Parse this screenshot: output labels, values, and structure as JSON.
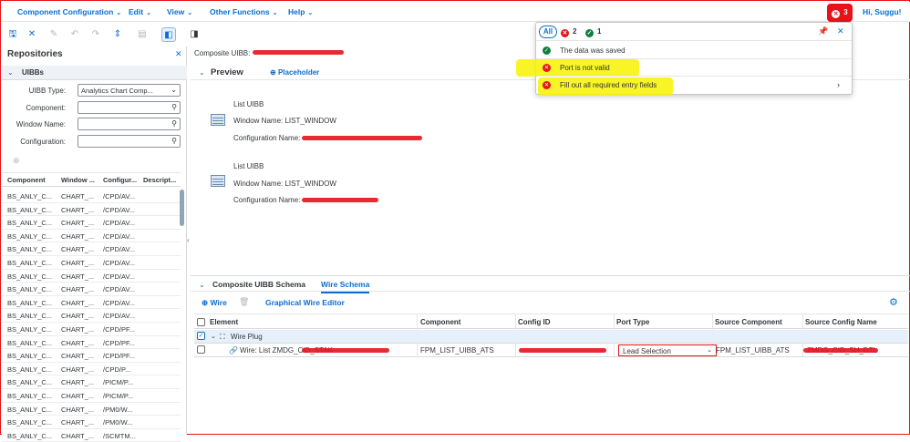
{
  "menubar": {
    "items": [
      {
        "label": "Component Configuration"
      },
      {
        "label": "Edit"
      },
      {
        "label": "View"
      },
      {
        "label": "Other Functions"
      },
      {
        "label": "Help"
      }
    ],
    "error_count": "3",
    "greeting": "Hi, Suggu!"
  },
  "toolbar": {
    "icons": [
      "save-icon",
      "cancel-icon",
      "edit-icon",
      "undo-icon",
      "redo-icon",
      "transport-icon",
      "print-icon",
      "left-panel-icon",
      "right-panel-icon"
    ]
  },
  "repositories": {
    "title": "Repositories",
    "section": "UIBBs",
    "filters": [
      {
        "label": "UIBB Type:",
        "value": "Analytics Chart Comp...",
        "icon": "dropdown-icon"
      },
      {
        "label": "Component:",
        "value": "",
        "icon": "search-icon"
      },
      {
        "label": "Window Name:",
        "value": "",
        "icon": "search-icon"
      },
      {
        "label": "Configuration:",
        "value": "",
        "icon": "search-icon"
      }
    ],
    "columns": [
      "Component",
      "Window ...",
      "Configur...",
      "Descript..."
    ],
    "rows": [
      [
        "BS_ANLY_C...",
        "CHART_...",
        "/CPD/AV...",
        ""
      ],
      [
        "BS_ANLY_C...",
        "CHART_...",
        "/CPD/AV...",
        ""
      ],
      [
        "BS_ANLY_C...",
        "CHART_...",
        "/CPD/AV...",
        ""
      ],
      [
        "BS_ANLY_C...",
        "CHART_...",
        "/CPD/AV...",
        ""
      ],
      [
        "BS_ANLY_C...",
        "CHART_...",
        "/CPD/AV...",
        ""
      ],
      [
        "BS_ANLY_C...",
        "CHART_...",
        "/CPD/AV...",
        ""
      ],
      [
        "BS_ANLY_C...",
        "CHART_...",
        "/CPD/AV...",
        ""
      ],
      [
        "BS_ANLY_C...",
        "CHART_...",
        "/CPD/AV...",
        ""
      ],
      [
        "BS_ANLY_C...",
        "CHART_...",
        "/CPD/AV...",
        ""
      ],
      [
        "BS_ANLY_C...",
        "CHART_...",
        "/CPD/AV...",
        ""
      ],
      [
        "BS_ANLY_C...",
        "CHART_...",
        "/CPD/PF...",
        ""
      ],
      [
        "BS_ANLY_C...",
        "CHART_...",
        "/CPD/PF...",
        ""
      ],
      [
        "BS_ANLY_C...",
        "CHART_...",
        "/CPD/PF...",
        ""
      ],
      [
        "BS_ANLY_C...",
        "CHART_...",
        "/CPD/P...",
        ""
      ],
      [
        "BS_ANLY_C...",
        "CHART_...",
        "/PICM/P...",
        ""
      ],
      [
        "BS_ANLY_C...",
        "CHART_...",
        "/PICM/P...",
        ""
      ],
      [
        "BS_ANLY_C...",
        "CHART_...",
        "/PM0/W...",
        ""
      ],
      [
        "BS_ANLY_C...",
        "CHART_...",
        "/PM0/W...",
        ""
      ],
      [
        "BS_ANLY_C...",
        "CHART_...",
        "/SCMTM...",
        ""
      ]
    ]
  },
  "main": {
    "breadcrumb": "Composite UIBB:",
    "preview": {
      "title": "Preview",
      "placeholder_link": "Placeholder",
      "uibbs": [
        {
          "type": "List UIBB",
          "window_name": "Window Name: LIST_WINDOW",
          "config_name": "Configuration Name:"
        },
        {
          "type": "List UIBB",
          "window_name": "Window Name: LIST_WINDOW",
          "config_name": "Configuration Name:"
        }
      ]
    },
    "schema": {
      "tabs": [
        {
          "label": "Composite UIBB Schema"
        },
        {
          "label": "Wire Schema"
        }
      ],
      "toolbar": {
        "wire_label": "Wire",
        "graphical_editor_label": "Graphical Wire Editor"
      },
      "columns": [
        "Element",
        "Component",
        "Config ID",
        "Port Type",
        "Source Component",
        "Source Config Name"
      ],
      "rows": [
        {
          "element": "Wire Plug",
          "component": "",
          "config_id": "",
          "port_type": "",
          "source_component": "",
          "source_config": ""
        },
        {
          "element": "Wire: List ZMDG_CID_STAK",
          "component": "FPM_LIST_UIBB_ATS",
          "config_id": "",
          "port_type": "Lead Selection",
          "source_component": "FPM_LIST_UIBB_ATS",
          "source_config": "ZMDG_CID_SH_DTL"
        }
      ]
    }
  },
  "messages": {
    "all_label": "All",
    "error_count": "2",
    "success_count": "1",
    "items": [
      {
        "status": "success",
        "text": "The data was saved"
      },
      {
        "status": "error",
        "text": "Port is not valid"
      },
      {
        "status": "error",
        "text": "Fill out all required entry fields"
      }
    ]
  },
  "colors": {
    "accent": "#0a6ed1",
    "error": "#e8121b",
    "success": "#107e3e",
    "highlight": "#f7f200"
  }
}
